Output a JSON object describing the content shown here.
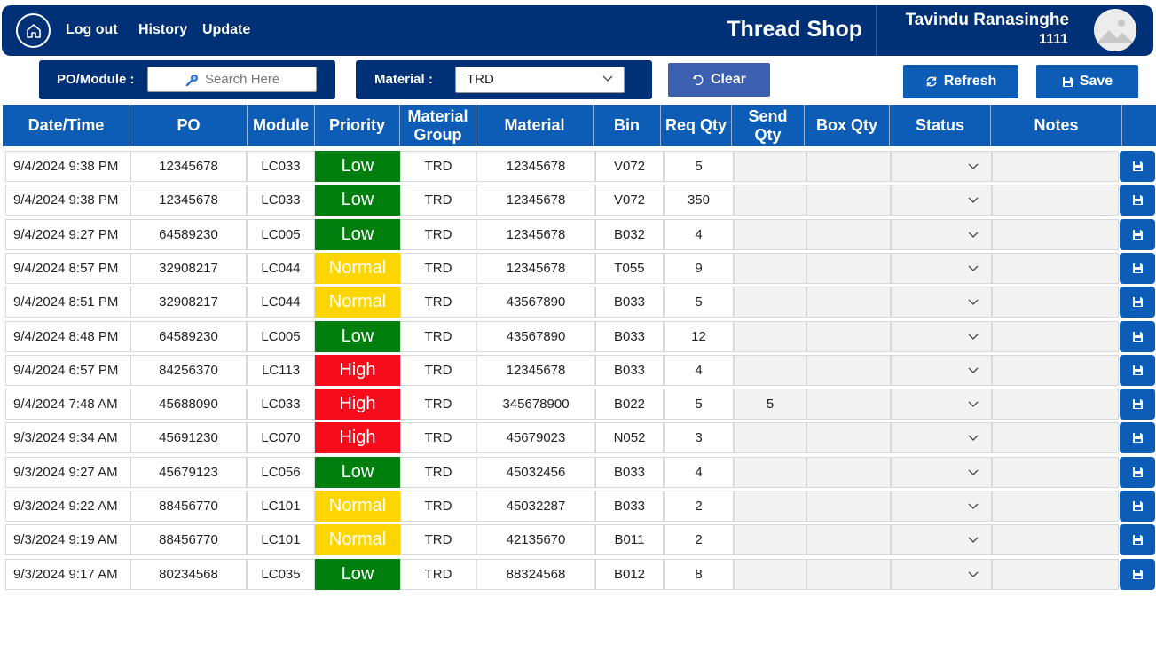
{
  "header": {
    "nav": {
      "logout": "Log out",
      "history": "History",
      "update": "Update"
    },
    "title": "Thread Shop",
    "user_name": "Tavindu Ranasinghe",
    "user_id": "1111"
  },
  "filters": {
    "po_label": "PO/Module :",
    "search_placeholder": "Search Here",
    "material_label": "Material :",
    "material_value": "TRD"
  },
  "buttons": {
    "clear": "Clear",
    "refresh": "Refresh",
    "save": "Save"
  },
  "table": {
    "columns": [
      "Date/Time",
      "PO",
      "Module",
      "Priority",
      "Material Group",
      "Material",
      "Bin",
      "Req Qty",
      "Send Qty",
      "Box Qty",
      "Status",
      "Notes"
    ],
    "rows": [
      {
        "datetime": "9/4/2024 9:38 PM",
        "po": "12345678",
        "module": "LC033",
        "priority": "Low",
        "group": "TRD",
        "material": "12345678",
        "bin": "V072",
        "req_qty": "5",
        "send_qty": ""
      },
      {
        "datetime": "9/4/2024 9:38 PM",
        "po": "12345678",
        "module": "LC033",
        "priority": "Low",
        "group": "TRD",
        "material": "12345678",
        "bin": "V072",
        "req_qty": "350",
        "send_qty": ""
      },
      {
        "datetime": "9/4/2024 9:27 PM",
        "po": "64589230",
        "module": "LC005",
        "priority": "Low",
        "group": "TRD",
        "material": "12345678",
        "bin": "B032",
        "req_qty": "4",
        "send_qty": ""
      },
      {
        "datetime": "9/4/2024 8:57 PM",
        "po": "32908217",
        "module": "LC044",
        "priority": "Normal",
        "group": "TRD",
        "material": "12345678",
        "bin": "T055",
        "req_qty": "9",
        "send_qty": ""
      },
      {
        "datetime": "9/4/2024 8:51 PM",
        "po": "32908217",
        "module": "LC044",
        "priority": "Normal",
        "group": "TRD",
        "material": "43567890",
        "bin": "B033",
        "req_qty": "5",
        "send_qty": ""
      },
      {
        "datetime": "9/4/2024 8:48 PM",
        "po": "64589230",
        "module": "LC005",
        "priority": "Low",
        "group": "TRD",
        "material": "43567890",
        "bin": "B033",
        "req_qty": "12",
        "send_qty": ""
      },
      {
        "datetime": "9/4/2024 6:57 PM",
        "po": "84256370",
        "module": "LC113",
        "priority": "High",
        "group": "TRD",
        "material": "12345678",
        "bin": "B033",
        "req_qty": "4",
        "send_qty": ""
      },
      {
        "datetime": "9/4/2024 7:48 AM",
        "po": "45688090",
        "module": "LC033",
        "priority": "High",
        "group": "TRD",
        "material": "345678900",
        "bin": "B022",
        "req_qty": "5",
        "send_qty": "5"
      },
      {
        "datetime": "9/3/2024 9:34 AM",
        "po": "45691230",
        "module": "LC070",
        "priority": "High",
        "group": "TRD",
        "material": "45679023",
        "bin": "N052",
        "req_qty": "3",
        "send_qty": ""
      },
      {
        "datetime": "9/3/2024 9:27 AM",
        "po": "45679123",
        "module": "LC056",
        "priority": "Low",
        "group": "TRD",
        "material": "45032456",
        "bin": "B033",
        "req_qty": "4",
        "send_qty": ""
      },
      {
        "datetime": "9/3/2024 9:22 AM",
        "po": "88456770",
        "module": "LC101",
        "priority": "Normal",
        "group": "TRD",
        "material": "45032287",
        "bin": "B033",
        "req_qty": "2",
        "send_qty": ""
      },
      {
        "datetime": "9/3/2024 9:19 AM",
        "po": "88456770",
        "module": "LC101",
        "priority": "Normal",
        "group": "TRD",
        "material": "42135670",
        "bin": "B011",
        "req_qty": "2",
        "send_qty": ""
      },
      {
        "datetime": "9/3/2024 9:17 AM",
        "po": "80234568",
        "module": "LC035",
        "priority": "Low",
        "group": "TRD",
        "material": "88324568",
        "bin": "B012",
        "req_qty": "8",
        "send_qty": ""
      }
    ]
  },
  "colors": {
    "header_bg": "#003076",
    "table_header_bg": "#0d5cb5",
    "priority_low": "#007f0e",
    "priority_normal": "#ffd500",
    "priority_high": "#f80c1c"
  },
  "icons": [
    "home-icon",
    "search-icon",
    "chevron-down-icon",
    "undo-icon",
    "refresh-icon",
    "save-icon",
    "image-placeholder-icon"
  ]
}
